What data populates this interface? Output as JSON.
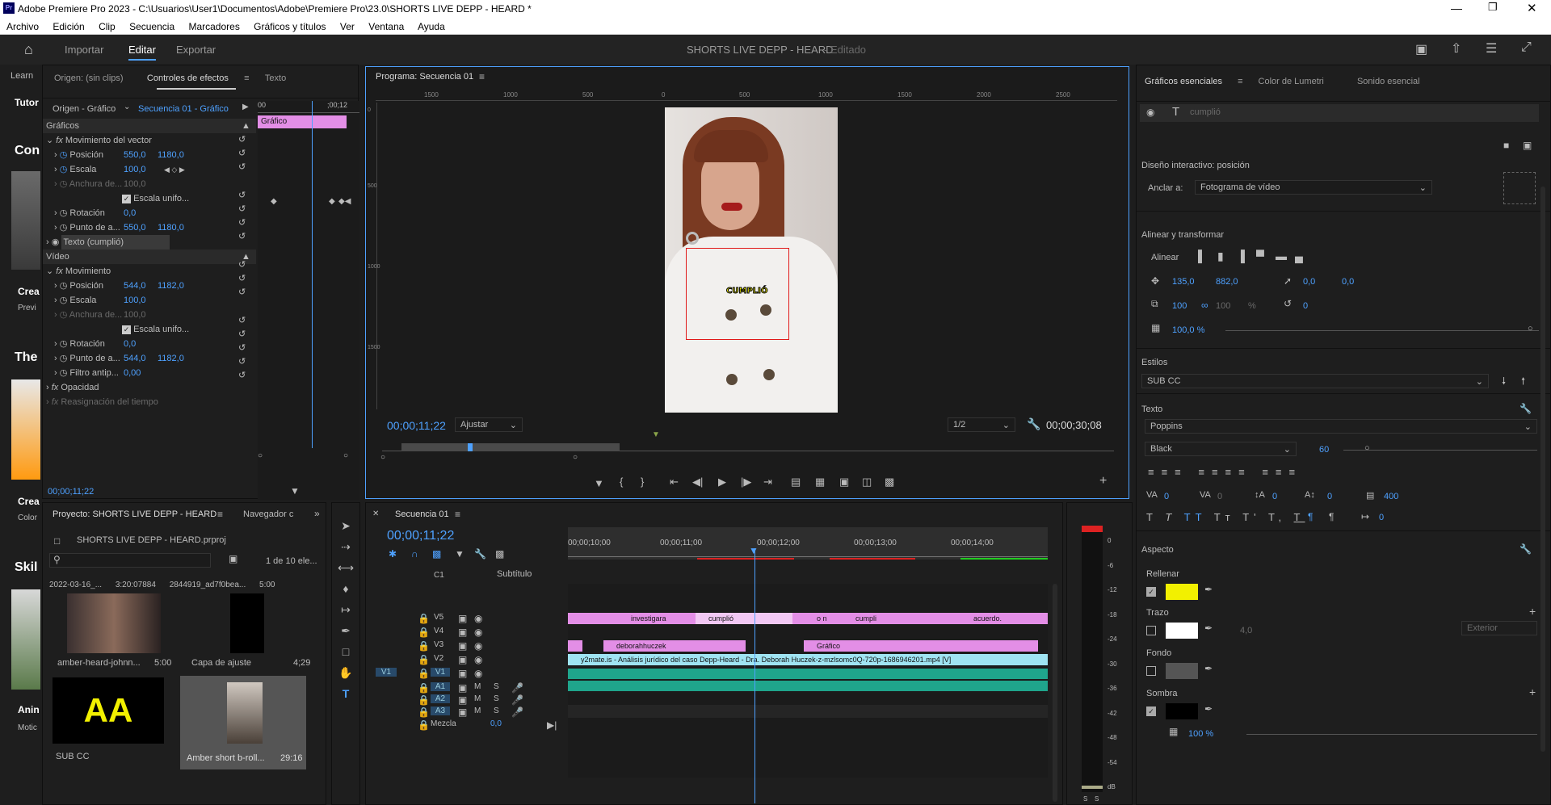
{
  "app": {
    "title": "Adobe Premiere Pro 2023 - C:\\Usuarios\\User1\\Documentos\\Adobe\\Premiere Pro\\23.0\\SHORTS LIVE DEPP - HEARD *",
    "logo": "Pr"
  },
  "menu": [
    "Archivo",
    "Edición",
    "Clip",
    "Secuencia",
    "Marcadores",
    "Gráficos y títulos",
    "Ver",
    "Ventana",
    "Ayuda"
  ],
  "header": {
    "tabs": [
      "Importar",
      "Editar",
      "Exportar"
    ],
    "active": "Editar",
    "project_title": "SHORTS LIVE DEPP - HEARD",
    "project_status": "- Editado"
  },
  "left_strip": {
    "tab_learn": "Learn",
    "tutor": "Tutor",
    "items": [
      "Con",
      "Crea",
      "Previ",
      "The",
      "Crea",
      "Color",
      "Skil",
      "Anin",
      "Motic"
    ]
  },
  "source_tabs": [
    "Origen: (sin clips)",
    "Controles de efectos",
    "Texto"
  ],
  "effect_controls": {
    "source_label": "Origen - Gráfico",
    "sequence_label": "Secuencia 01 - Gráfico",
    "timecode_start": "00",
    "timecode_end": ";00;12",
    "clip_label": "Gráfico",
    "graficos": "Gráficos",
    "vector_motion": "Movimiento del vector",
    "v_position_label": "Posición",
    "v_position_x": "550,0",
    "v_position_y": "1180,0",
    "v_scale_label": "Escala",
    "v_scale": "100,0",
    "v_width_label": "Anchura de...",
    "v_width": "100,0",
    "v_uniform": "Escala unifo...",
    "v_rotation_label": "Rotación",
    "v_rotation": "0,0",
    "v_anchor_label": "Punto de a...",
    "v_anchor_x": "550,0",
    "v_anchor_y": "1180,0",
    "text_layer": "Texto (cumplió)",
    "video": "Vídeo",
    "motion": "Movimiento",
    "m_position_label": "Posición",
    "m_position_x": "544,0",
    "m_position_y": "1182,0",
    "m_scale_label": "Escala",
    "m_scale": "100,0",
    "m_width_label": "Anchura de...",
    "m_width": "100,0",
    "m_uniform": "Escala unifo...",
    "m_rotation_label": "Rotación",
    "m_rotation": "0,0",
    "m_anchor_label": "Punto de a...",
    "m_anchor_x": "544,0",
    "m_anchor_y": "1182,0",
    "m_filter_label": "Filtro antip...",
    "m_filter": "0,00",
    "opacity": "Opacidad",
    "time_remap": "Reasignación del tiempo",
    "footer_timecode": "00;00;11;22"
  },
  "program": {
    "tab": "Programa: Secuencia 01",
    "ruler": [
      "1500",
      "1000",
      "500",
      "0",
      "500",
      "1000",
      "1500",
      "2000",
      "2500"
    ],
    "vruler": [
      "0",
      "500",
      "1000",
      "1500"
    ],
    "overlay_text": "CUMPLIÓ",
    "timecode": "00;00;11;22",
    "fit": "Ajustar",
    "resolution": "1/2",
    "duration": "00;00;30;08"
  },
  "project": {
    "tabs": [
      "Proyecto: SHORTS LIVE DEPP - HEARD",
      "Navegador c"
    ],
    "file": "SHORTS LIVE DEPP - HEARD.prproj",
    "count": "1 de 10 ele...",
    "head": [
      "2022-03-16_...",
      "3:20:07884",
      "2844919_ad7f0bea...",
      "5:00"
    ],
    "items": [
      {
        "name": "amber-heard-johnn...",
        "dur": "5:00"
      },
      {
        "name": "Capa de ajuste",
        "dur": "4;29"
      },
      {
        "name": "SUB CC",
        "dur": "",
        "thumb_text": "AA"
      },
      {
        "name": "Amber short b-roll...",
        "dur": "29:16"
      }
    ]
  },
  "timeline": {
    "tab": "Secuencia 01",
    "timecode": "00;00;11;22",
    "ruler": [
      "00;00;10;00",
      "00;00;11;00",
      "00;00;12;00",
      "00;00;13;00",
      "00;00;14;00"
    ],
    "subtitle_label": "Subtítulo",
    "c1": "C1",
    "tracks_video": [
      "V5",
      "V4",
      "V3",
      "V2",
      "V1"
    ],
    "tracks_audio": [
      "A1",
      "A2",
      "A3"
    ],
    "v1_source": "V1",
    "mix_label": "Mezcla",
    "mix_value": "0,0",
    "m": "M",
    "s": "S",
    "clips": {
      "v4": [
        "investigara",
        "cumplió",
        "o n",
        "cumpli",
        "acuerdo."
      ],
      "v2": [
        "deborahhuczek",
        "Gráfico"
      ],
      "v1": "y2mate.is - Análisis jurídico del caso Depp-Heard - Dra. Deborah Huczek-z-mzlsomc0Q-720p-1686946201.mp4 [V]"
    }
  },
  "meter": {
    "scale": [
      "0",
      "-6",
      "-12",
      "-18",
      "-24",
      "-30",
      "-36",
      "-42",
      "-48",
      "-54",
      "dB"
    ],
    "s_labels": [
      "S",
      "S"
    ]
  },
  "essential": {
    "tabs": [
      "Gráficos esenciales",
      "Color de Lumetri",
      "Sonido esencial"
    ],
    "layer": "cumplió",
    "responsive": "Diseño interactivo: posición",
    "anchor_label": "Anclar a:",
    "anchor_value": "Fotograma de vídeo",
    "align_title": "Alinear y transformar",
    "align_label": "Alinear",
    "pos_x": "135,0",
    "pos_y": "882,0",
    "anchor_x": "0,0",
    "anchor_y": "0,0",
    "scale": "100",
    "scale2": "100",
    "pct": "%",
    "rotation": "0",
    "opacity": "100,0 %",
    "styles_title": "Estilos",
    "style_value": "SUB CC",
    "text_title": "Texto",
    "font": "Poppins",
    "weight": "Black",
    "size": "60",
    "tracking": "0",
    "kerning": "0",
    "baseline": "0",
    "tsume": "0",
    "leading": "400",
    "tab": "0",
    "indent": "0",
    "appearance_title": "Aspecto",
    "fill_label": "Rellenar",
    "fill_color": "#f2f000",
    "stroke_label": "Trazo",
    "stroke_color": "#ffffff",
    "stroke_size": "4,0",
    "stroke_type": "Exterior",
    "bg_label": "Fondo",
    "bg_color": "#555555",
    "shadow_label": "Sombra",
    "shadow_color": "#000000",
    "shadow_opacity": "100 %"
  }
}
